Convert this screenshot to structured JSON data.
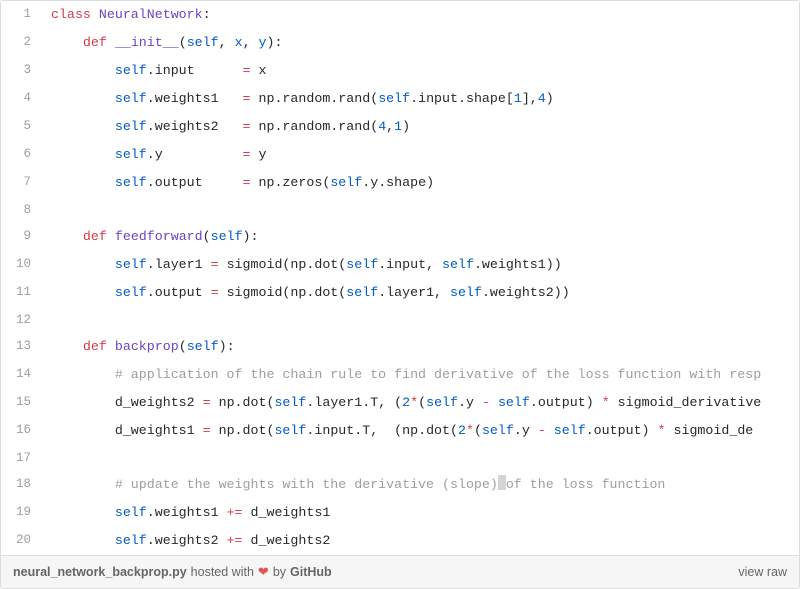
{
  "footer": {
    "filename": "neural_network_backprop.py",
    "hosted_prefix": " hosted with ",
    "by_text": " by ",
    "github_text": "GitHub",
    "view_raw": "view raw"
  },
  "lines": [
    {
      "n": 1,
      "indent": 0,
      "segs": [
        {
          "c": "tok-kw",
          "t": "class"
        },
        {
          "c": "tok-default",
          "t": " "
        },
        {
          "c": "tok-name",
          "t": "NeuralNetwork"
        },
        {
          "c": "tok-default",
          "t": ":"
        }
      ]
    },
    {
      "n": 2,
      "indent": 1,
      "segs": [
        {
          "c": "tok-kw",
          "t": "def"
        },
        {
          "c": "tok-default",
          "t": " "
        },
        {
          "c": "tok-name",
          "t": "__init__"
        },
        {
          "c": "tok-default",
          "t": "("
        },
        {
          "c": "tok-self",
          "t": "self"
        },
        {
          "c": "tok-default",
          "t": ", "
        },
        {
          "c": "tok-self",
          "t": "x"
        },
        {
          "c": "tok-default",
          "t": ", "
        },
        {
          "c": "tok-self",
          "t": "y"
        },
        {
          "c": "tok-default",
          "t": "):"
        }
      ]
    },
    {
      "n": 3,
      "indent": 2,
      "segs": [
        {
          "c": "tok-self",
          "t": "self"
        },
        {
          "c": "tok-default",
          "t": ".input      "
        },
        {
          "c": "tok-op",
          "t": "="
        },
        {
          "c": "tok-default",
          "t": " x"
        }
      ]
    },
    {
      "n": 4,
      "indent": 2,
      "segs": [
        {
          "c": "tok-self",
          "t": "self"
        },
        {
          "c": "tok-default",
          "t": ".weights1   "
        },
        {
          "c": "tok-op",
          "t": "="
        },
        {
          "c": "tok-default",
          "t": " np.random.rand("
        },
        {
          "c": "tok-self",
          "t": "self"
        },
        {
          "c": "tok-default",
          "t": ".input.shape["
        },
        {
          "c": "tok-self",
          "t": "1"
        },
        {
          "c": "tok-default",
          "t": "],"
        },
        {
          "c": "tok-self",
          "t": "4"
        },
        {
          "c": "tok-default",
          "t": ") "
        }
      ]
    },
    {
      "n": 5,
      "indent": 2,
      "segs": [
        {
          "c": "tok-self",
          "t": "self"
        },
        {
          "c": "tok-default",
          "t": ".weights2   "
        },
        {
          "c": "tok-op",
          "t": "="
        },
        {
          "c": "tok-default",
          "t": " np.random.rand("
        },
        {
          "c": "tok-self",
          "t": "4"
        },
        {
          "c": "tok-default",
          "t": ","
        },
        {
          "c": "tok-self",
          "t": "1"
        },
        {
          "c": "tok-default",
          "t": ")                 "
        }
      ]
    },
    {
      "n": 6,
      "indent": 2,
      "segs": [
        {
          "c": "tok-self",
          "t": "self"
        },
        {
          "c": "tok-default",
          "t": ".y          "
        },
        {
          "c": "tok-op",
          "t": "="
        },
        {
          "c": "tok-default",
          "t": " y"
        }
      ]
    },
    {
      "n": 7,
      "indent": 2,
      "segs": [
        {
          "c": "tok-self",
          "t": "self"
        },
        {
          "c": "tok-default",
          "t": ".output     "
        },
        {
          "c": "tok-op",
          "t": "="
        },
        {
          "c": "tok-default",
          "t": " np.zeros("
        },
        {
          "c": "tok-self",
          "t": "self"
        },
        {
          "c": "tok-default",
          "t": ".y.shape)"
        }
      ]
    },
    {
      "n": 8,
      "indent": 0,
      "segs": []
    },
    {
      "n": 9,
      "indent": 1,
      "segs": [
        {
          "c": "tok-kw",
          "t": "def"
        },
        {
          "c": "tok-default",
          "t": " "
        },
        {
          "c": "tok-name",
          "t": "feedforward"
        },
        {
          "c": "tok-default",
          "t": "("
        },
        {
          "c": "tok-self",
          "t": "self"
        },
        {
          "c": "tok-default",
          "t": "):"
        }
      ]
    },
    {
      "n": 10,
      "indent": 2,
      "segs": [
        {
          "c": "tok-self",
          "t": "self"
        },
        {
          "c": "tok-default",
          "t": ".layer1 "
        },
        {
          "c": "tok-op",
          "t": "="
        },
        {
          "c": "tok-default",
          "t": " sigmoid(np.dot("
        },
        {
          "c": "tok-self",
          "t": "self"
        },
        {
          "c": "tok-default",
          "t": ".input, "
        },
        {
          "c": "tok-self",
          "t": "self"
        },
        {
          "c": "tok-default",
          "t": ".weights1))"
        }
      ]
    },
    {
      "n": 11,
      "indent": 2,
      "segs": [
        {
          "c": "tok-self",
          "t": "self"
        },
        {
          "c": "tok-default",
          "t": ".output "
        },
        {
          "c": "tok-op",
          "t": "="
        },
        {
          "c": "tok-default",
          "t": " sigmoid(np.dot("
        },
        {
          "c": "tok-self",
          "t": "self"
        },
        {
          "c": "tok-default",
          "t": ".layer1, "
        },
        {
          "c": "tok-self",
          "t": "self"
        },
        {
          "c": "tok-default",
          "t": ".weights2))"
        }
      ]
    },
    {
      "n": 12,
      "indent": 0,
      "segs": []
    },
    {
      "n": 13,
      "indent": 1,
      "segs": [
        {
          "c": "tok-kw",
          "t": "def"
        },
        {
          "c": "tok-default",
          "t": " "
        },
        {
          "c": "tok-name",
          "t": "backprop"
        },
        {
          "c": "tok-default",
          "t": "("
        },
        {
          "c": "tok-self",
          "t": "self"
        },
        {
          "c": "tok-default",
          "t": "):"
        }
      ]
    },
    {
      "n": 14,
      "indent": 2,
      "segs": [
        {
          "c": "tok-comment",
          "t": "# application of the chain rule to find derivative of the loss function with resp"
        }
      ]
    },
    {
      "n": 15,
      "indent": 2,
      "segs": [
        {
          "c": "tok-default",
          "t": "d_weights2 "
        },
        {
          "c": "tok-op",
          "t": "="
        },
        {
          "c": "tok-default",
          "t": " np.dot("
        },
        {
          "c": "tok-self",
          "t": "self"
        },
        {
          "c": "tok-default",
          "t": ".layer1.T, ("
        },
        {
          "c": "tok-self",
          "t": "2"
        },
        {
          "c": "tok-op",
          "t": "*"
        },
        {
          "c": "tok-default",
          "t": "("
        },
        {
          "c": "tok-self",
          "t": "self"
        },
        {
          "c": "tok-default",
          "t": ".y "
        },
        {
          "c": "tok-op",
          "t": "-"
        },
        {
          "c": "tok-default",
          "t": " "
        },
        {
          "c": "tok-self",
          "t": "self"
        },
        {
          "c": "tok-default",
          "t": ".output) "
        },
        {
          "c": "tok-op",
          "t": "*"
        },
        {
          "c": "tok-default",
          "t": " sigmoid_derivative"
        }
      ]
    },
    {
      "n": 16,
      "indent": 2,
      "segs": [
        {
          "c": "tok-default",
          "t": "d_weights1 "
        },
        {
          "c": "tok-op",
          "t": "="
        },
        {
          "c": "tok-default",
          "t": " np.dot("
        },
        {
          "c": "tok-self",
          "t": "self"
        },
        {
          "c": "tok-default",
          "t": ".input.T,  (np.dot("
        },
        {
          "c": "tok-self",
          "t": "2"
        },
        {
          "c": "tok-op",
          "t": "*"
        },
        {
          "c": "tok-default",
          "t": "("
        },
        {
          "c": "tok-self",
          "t": "self"
        },
        {
          "c": "tok-default",
          "t": ".y "
        },
        {
          "c": "tok-op",
          "t": "-"
        },
        {
          "c": "tok-default",
          "t": " "
        },
        {
          "c": "tok-self",
          "t": "self"
        },
        {
          "c": "tok-default",
          "t": ".output) "
        },
        {
          "c": "tok-op",
          "t": "*"
        },
        {
          "c": "tok-default",
          "t": " sigmoid_de"
        }
      ]
    },
    {
      "n": 17,
      "indent": 0,
      "segs": []
    },
    {
      "n": 18,
      "indent": 2,
      "segs": [
        {
          "c": "tok-comment",
          "t": "# update the weights with the derivative (slope)"
        },
        {
          "c": "cursor",
          "t": ""
        },
        {
          "c": "tok-comment",
          "t": "of the loss function"
        }
      ]
    },
    {
      "n": 19,
      "indent": 2,
      "segs": [
        {
          "c": "tok-self",
          "t": "self"
        },
        {
          "c": "tok-default",
          "t": ".weights1 "
        },
        {
          "c": "tok-op",
          "t": "+="
        },
        {
          "c": "tok-default",
          "t": " d_weights1"
        }
      ]
    },
    {
      "n": 20,
      "indent": 2,
      "segs": [
        {
          "c": "tok-self",
          "t": "self"
        },
        {
          "c": "tok-default",
          "t": ".weights2 "
        },
        {
          "c": "tok-op",
          "t": "+="
        },
        {
          "c": "tok-default",
          "t": " d_weights2"
        }
      ]
    }
  ]
}
